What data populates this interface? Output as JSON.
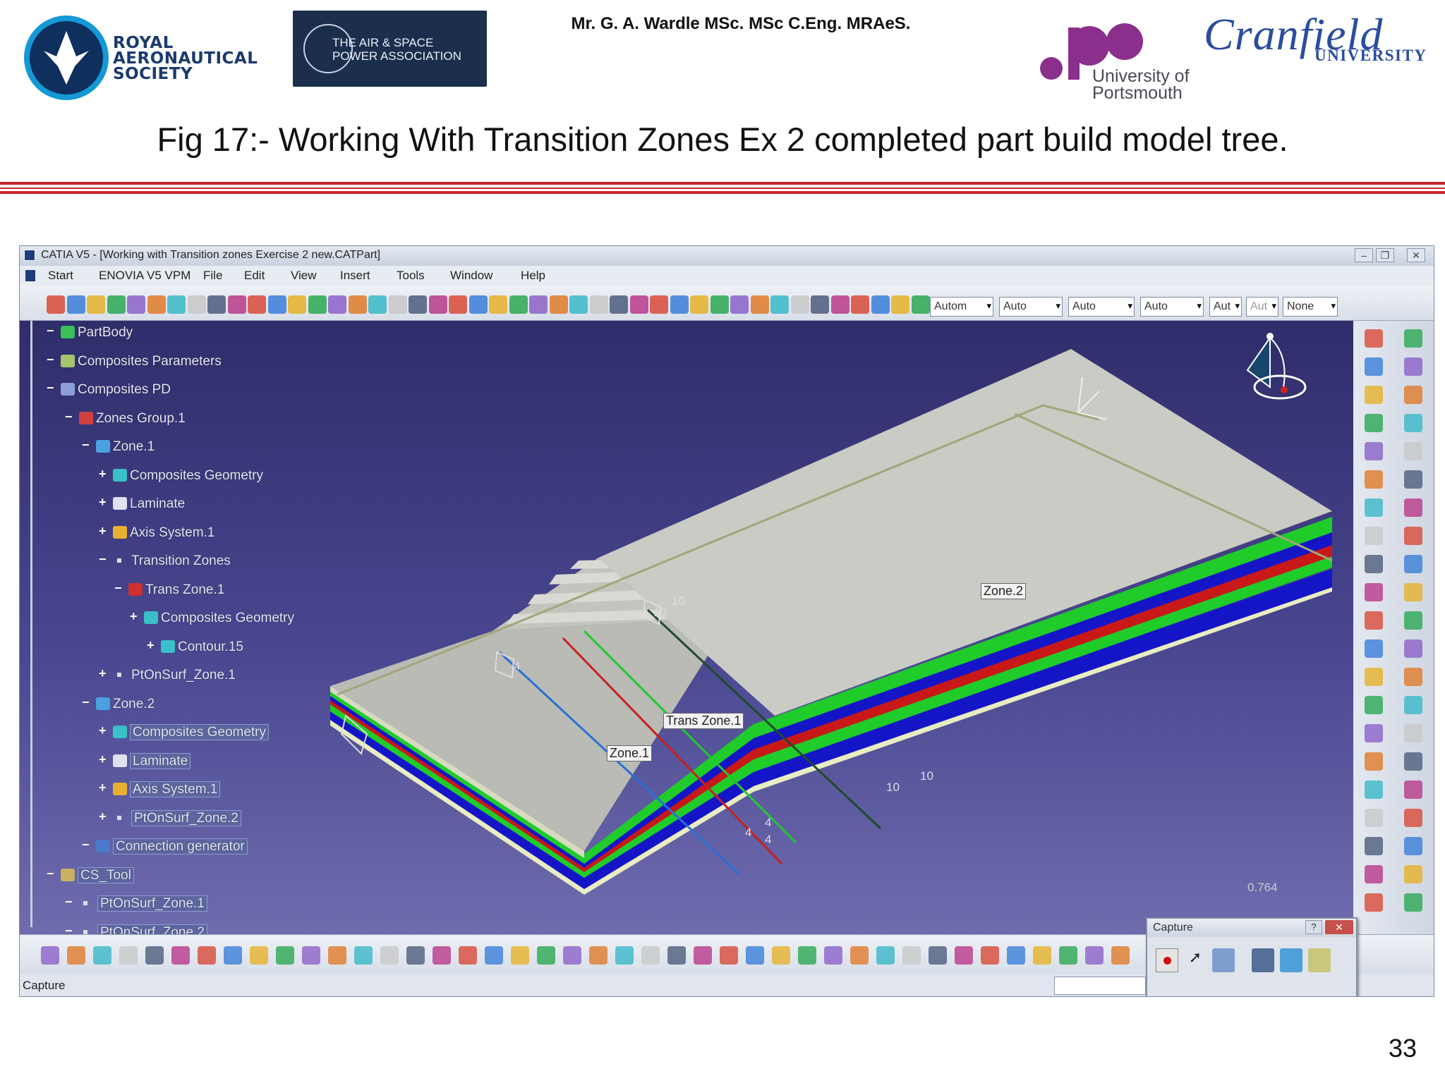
{
  "header": {
    "raes_text": [
      "ROYAL",
      "AERONAUTICAL",
      "SOCIETY"
    ],
    "asp_text": [
      "THE AIR & SPACE",
      "POWER ASSOCIATION"
    ],
    "author": "Mr. G. A. Wardle MSc. MSc C.Eng. MRAeS.",
    "uop_text": [
      "University of",
      "Portsmouth"
    ],
    "cranfield_text": "Cranfield",
    "cranfield_sub": "UNIVERSITY"
  },
  "figure_title": "Fig 17:- Working With Transition Zones Ex 2 completed part build model tree.",
  "page_number": "33",
  "catia": {
    "window_title": "CATIA V5 - [Working with Transition zones Exercise 2 new.CATPart]",
    "menu": [
      "Start",
      "ENOVIA V5 VPM",
      "File",
      "Edit",
      "View",
      "Insert",
      "Tools",
      "Window",
      "Help"
    ],
    "combos": [
      "Autom",
      "Auto",
      "Auto",
      "Auto",
      "Aut",
      "Aut",
      "None"
    ],
    "tree": [
      {
        "label": "PartBody",
        "level": 0,
        "color": "#3bbf5a"
      },
      {
        "label": "Composites Parameters",
        "level": 0,
        "color": "#a6c56a"
      },
      {
        "label": "Composites PD",
        "level": 0,
        "color": "#8c9fd4"
      },
      {
        "label": "Zones Group.1",
        "level": 1,
        "color": "#d04040"
      },
      {
        "label": "Zone.1",
        "level": 2,
        "color": "#4aa0e0"
      },
      {
        "label": "Composites Geometry",
        "level": 3,
        "color": "#39c0c8"
      },
      {
        "label": "Laminate",
        "level": 3,
        "color": "#e0e0f0"
      },
      {
        "label": "Axis System.1",
        "level": 3,
        "color": "#e8b030"
      },
      {
        "label": "Transition Zones",
        "level": 3,
        "color": ""
      },
      {
        "label": "Trans Zone.1",
        "level": 4,
        "color": "#d03030"
      },
      {
        "label": "Composites Geometry",
        "level": 5,
        "color": "#39c0c8"
      },
      {
        "label": "Contour.15",
        "level": 6,
        "color": "#39c0c8"
      },
      {
        "label": "PtOnSurf_Zone.1",
        "level": 3,
        "color": ""
      },
      {
        "label": "Zone.2",
        "level": 2,
        "color": "#4aa0e0"
      },
      {
        "label": "Composites Geometry",
        "level": 3,
        "color": "#39c0c8",
        "boxed": true
      },
      {
        "label": "Laminate",
        "level": 3,
        "color": "#e0e0f0",
        "boxed": true
      },
      {
        "label": "Axis System.1",
        "level": 3,
        "color": "#e8b030",
        "boxed": true
      },
      {
        "label": "PtOnSurf_Zone.2",
        "level": 3,
        "color": "",
        "boxed": true
      },
      {
        "label": "Connection generator",
        "level": 2,
        "color": "#4a7acc",
        "boxed": true
      },
      {
        "label": "CS_Tool",
        "level": 0,
        "color": "#c8b060",
        "boxed": true
      },
      {
        "label": "PtOnSurf_Zone.1",
        "level": 1,
        "color": "",
        "boxed": true
      },
      {
        "label": "PtOnSurf_Zone.2",
        "level": 1,
        "color": "",
        "boxed": true
      }
    ],
    "model_labels": {
      "zone2": "Zone.2",
      "trans_zone1": "Trans Zone.1",
      "zone1": "Zone.1"
    },
    "model_numbers": [
      "10",
      "10",
      "4",
      "10",
      "10",
      "4",
      "4",
      "4"
    ],
    "scale_value": "0.764",
    "capture_title": "Capture",
    "status_text": "Capture",
    "ply_colors": [
      "#e9ecc0",
      "#1515c8",
      "#1fcc2a",
      "#c81818",
      "#1515c8",
      "#1fcc2a"
    ]
  }
}
